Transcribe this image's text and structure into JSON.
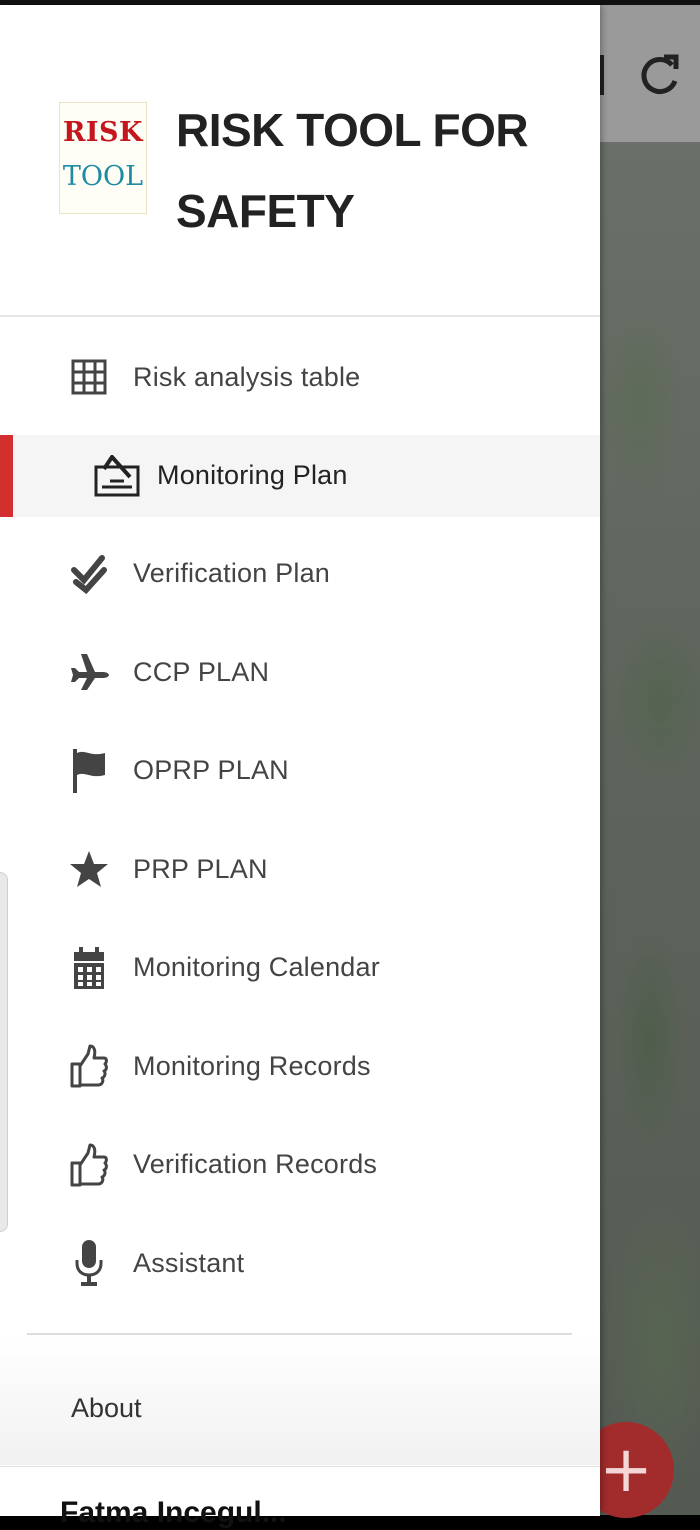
{
  "app": {
    "title": "RISK TOOL FOR SAFETY",
    "logo_line1": "RISK",
    "logo_line2": "TOOL"
  },
  "menu": {
    "items": [
      {
        "label": "Risk analysis table",
        "icon": "table-grid-icon",
        "selected": false
      },
      {
        "label": "Monitoring Plan",
        "icon": "signature-icon",
        "selected": true
      },
      {
        "label": "Verification Plan",
        "icon": "double-check-icon",
        "selected": false
      },
      {
        "label": "CCP PLAN",
        "icon": "plane-icon",
        "selected": false
      },
      {
        "label": "OPRP PLAN",
        "icon": "flag-icon",
        "selected": false
      },
      {
        "label": "PRP PLAN",
        "icon": "star-icon",
        "selected": false
      },
      {
        "label": "Monitoring Calendar",
        "icon": "calendar-icon",
        "selected": false
      },
      {
        "label": "Monitoring Records",
        "icon": "thumbs-up-icon",
        "selected": false
      },
      {
        "label": "Verification Records",
        "icon": "thumbs-up-icon",
        "selected": false
      },
      {
        "label": "Assistant",
        "icon": "microphone-icon",
        "selected": false
      }
    ]
  },
  "footer": {
    "about_label": "About",
    "user_name": "Fatma Incegul..."
  },
  "background": {
    "fab_label": "+",
    "icons": [
      "save-icon",
      "refresh-icon"
    ]
  },
  "colors": {
    "accent": "#d32f2f",
    "fab": "#a22b2b",
    "text": "#444444"
  }
}
